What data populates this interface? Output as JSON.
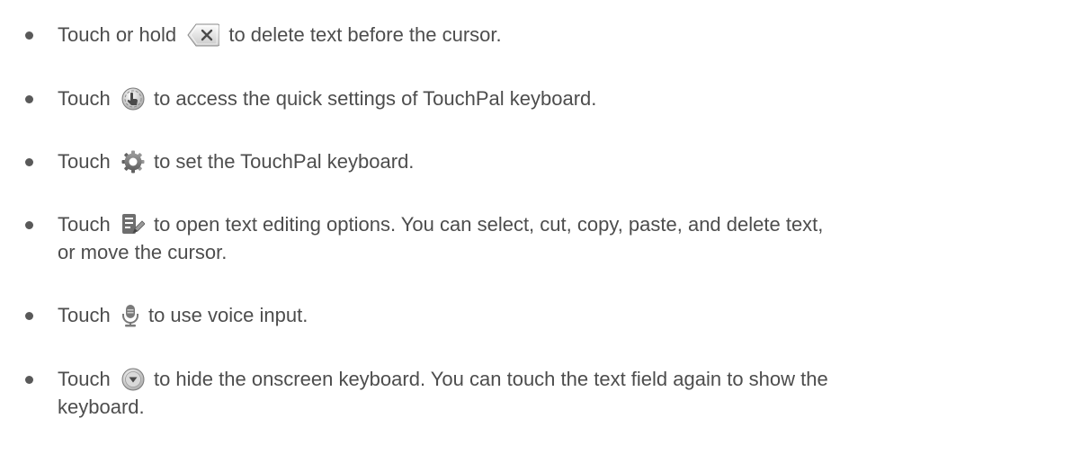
{
  "items": [
    {
      "before": "Touch or hold",
      "icon": "backspace-delete-icon",
      "after": "to delete text before the cursor."
    },
    {
      "before": "Touch",
      "icon": "touchpal-quick-settings-icon",
      "after": "to access the quick settings of TouchPal keyboard."
    },
    {
      "before": "Touch",
      "icon": "gear-icon",
      "after": "to set the TouchPal keyboard."
    },
    {
      "before": "Touch",
      "icon": "text-edit-icon",
      "after": "to open text editing options. You can select, cut, copy, paste, and delete text,",
      "continuation": "or move the cursor."
    },
    {
      "before": "Touch",
      "icon": "microphone-icon",
      "after": "to use voice input."
    },
    {
      "before": "Touch",
      "icon": "hide-keyboard-icon",
      "after": "to hide the onscreen keyboard. You can touch the text field again to show the",
      "continuation": "keyboard."
    }
  ]
}
